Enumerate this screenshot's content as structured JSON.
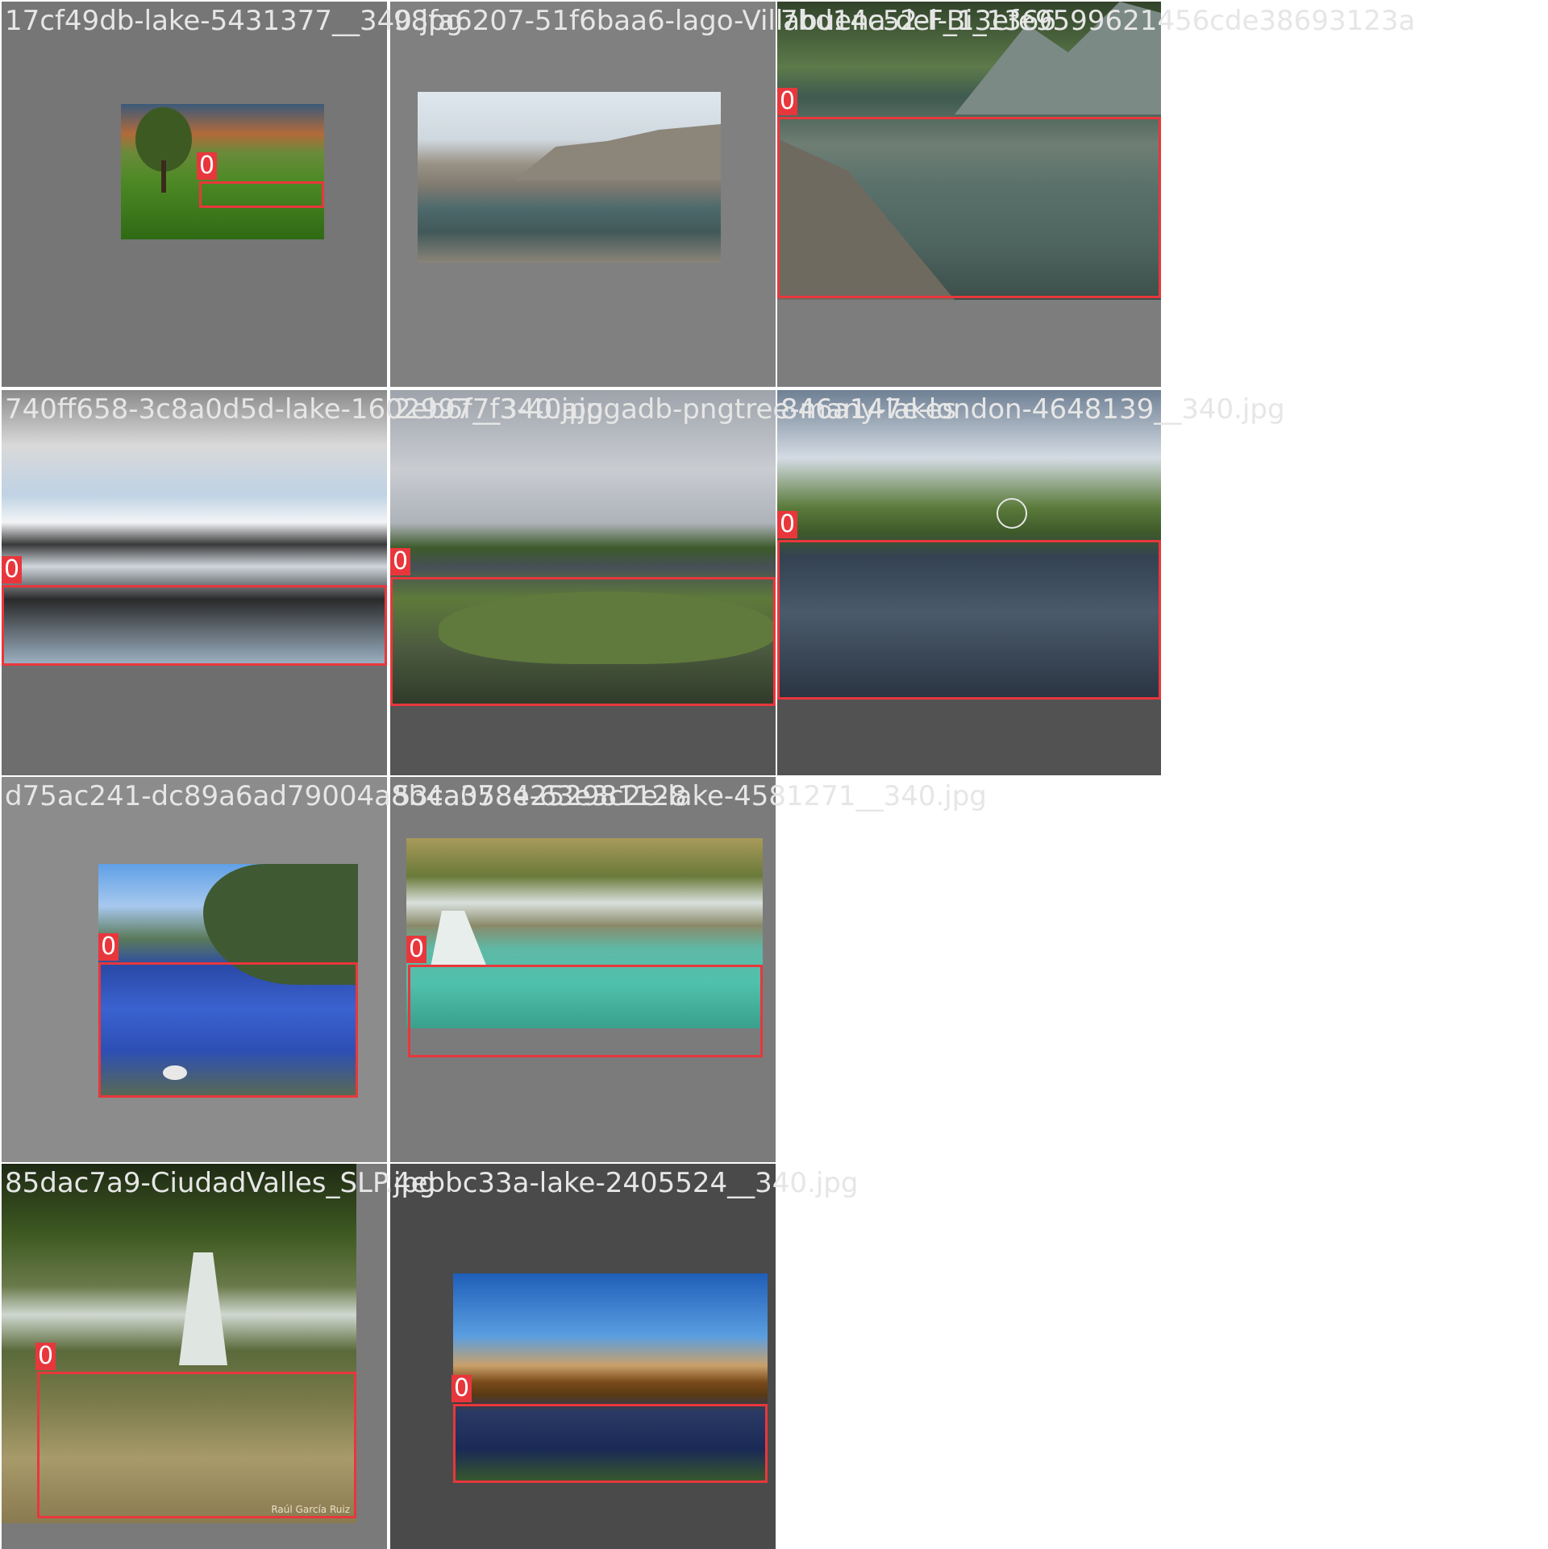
{
  "mosaic": {
    "tiles": [
      {
        "filename": "17cf49db-lake-5431377__340.jpg",
        "cell_bg": "#767676",
        "photo_bg": "linear-gradient(180deg,#3b5a7a 0%,#b26a3a 22%,#6a8a3a 36%,#4f8a26 55%,#2f6a14 100%)",
        "detections": [
          {
            "label": "0"
          }
        ]
      },
      {
        "filename": "98fa6207-51f6baa6-lago-Villabuena-del-Bi_1366",
        "cell_bg": "#808080",
        "photo_bg": "linear-gradient(180deg,#dfe7ee 0%,#cfd8de 28%,#9a9286 42%,#7f7a70 55%,#4e6a6c 68%,#42595a 82%,#8a8478 100%)",
        "detections": []
      },
      {
        "filename": "7bd14c52-F_13efe9599621456cde38693123a",
        "cell_bg": "#7d7d7d",
        "photo_bg": "linear-gradient(180deg,#31432a 0%,#5c7a4a 22%,#3f5a50 32%,#6f7e74 48%,#59716a 62%,#4f6660 80%,#3d4f4a 100%)",
        "detections": [
          {
            "label": "0"
          }
        ]
      },
      {
        "filename": "740ff658-3c8a0d5d-lake-1602997__340.jpg",
        "cell_bg": "#6e6e6e",
        "photo_bg": "linear-gradient(180deg,#8a8a8a 0%,#d9d9d9 20%,#bfd2e4 38%,#f2f4f6 48%,#3a3a3a 56%,#cfd6dc 64%,#2a2a2a 76%,#9fb4c6 100%)",
        "detections": [
          {
            "label": "0"
          }
        ]
      },
      {
        "filename": "2eb6f7f3-40ajpgadb-pngtree-many-lakes",
        "cell_bg": "#555555",
        "photo_bg": "linear-gradient(180deg,#9ea3ab 0%,#c9ccd1 25%,#aeb3ba 42%,#3c5a2a 50%,#465057 56%,#5e7a3a 66%,#4c5a40 82%,#2e3a28 100%)",
        "detections": [
          {
            "label": "0"
          }
        ]
      },
      {
        "filename": "846a147e-london-4648139__340.jpg",
        "cell_bg": "#525252",
        "photo_bg": "linear-gradient(180deg,#6f8094 0%,#d4dbe3 22%,#5a7a3a 38%,#3e5a2a 46%,#344252 54%,#4a5a6a 72%,#2a3442 100%)",
        "detections": [
          {
            "label": "0"
          }
        ]
      },
      {
        "filename": "d75ac241-dc89a6ad79004a8b4a3784252981128",
        "cell_bg": "#8c8c8c",
        "photo_bg": "linear-gradient(180deg,#5fa0e6 0%,#a7c8ee 18%,#5b7a5a 32%,#2b4aa8 44%,#3a62d0 62%,#2d4fb4 80%,#5a6a50 100%)",
        "detections": [
          {
            "label": "0"
          }
        ]
      },
      {
        "filename": "53ca058e-63e3c2e-lake-4581271__340.jpg",
        "cell_bg": "#7b7b7b",
        "photo_bg": "linear-gradient(180deg,#a89a5a 0%,#6a7a3a 20%,#d8e0dc 34%,#8a8a6a 46%,#5fb8a6 58%,#4fc1ac 76%,#3aa08c 100%)",
        "detections": [
          {
            "label": "0"
          }
        ]
      },
      {
        "filename": "85dac7a9-CiudadValles_SLP.jpg",
        "cell_bg": "#7a7a7a",
        "photo_bg": "linear-gradient(180deg,#1e2a14 0%,#3f5a22 20%,#6a7a4a 34%,#cfd8d0 42%,#5a6a3a 52%,#7a7a4a 66%,#a89a6a 82%,#8a7a50 100%)",
        "detections": [
          {
            "label": "0"
          }
        ]
      },
      {
        "filename": "4ebbc33a-lake-2405524__340.jpg",
        "cell_bg": "#4a4a4a",
        "photo_bg": "linear-gradient(180deg,#1f5eb8 0%,#5a9ee0 30%,#c9a06a 44%,#7a4a1a 52%,#5a3a14 58%,#2a3a64 66%,#1a2a56 84%,#3a5a2a 100%)",
        "detections": [
          {
            "label": "0"
          }
        ]
      }
    ],
    "photo_credit": "Raúl García Ruiz"
  },
  "colors": {
    "bbox": "#e8373c",
    "filename_text": "#e6e6e6"
  }
}
